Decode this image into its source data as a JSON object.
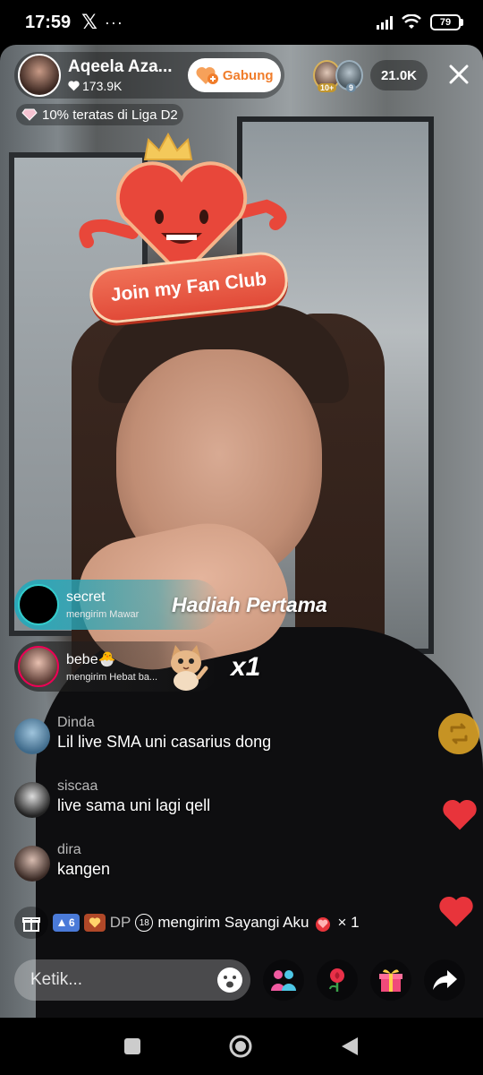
{
  "status_bar": {
    "time": "17:59",
    "x_app": "𝕏",
    "more": "···",
    "battery": "79"
  },
  "host": {
    "name": "Aqeela Aza...",
    "likes": "173.9K",
    "join_label": "Gabung"
  },
  "viewers": {
    "badge1": "10+",
    "badge2": "9",
    "count": "21.0K"
  },
  "league": {
    "text": "10% teratas di Liga D2"
  },
  "fan_club": {
    "label": "Join my Fan Club"
  },
  "gifts": [
    {
      "user": "secret",
      "action": "mengirim Mawar"
    },
    {
      "user": "bebe🐣",
      "action": "mengirim Hebat ba..."
    }
  ],
  "gift_title": "Hadiah Pertama",
  "gift_multiplier": "x1",
  "comments": [
    {
      "user": "Dinda",
      "message": "Lil live SMA uni casarius dong"
    },
    {
      "user": "siscaa",
      "message": "live sama uni lagi qell"
    },
    {
      "user": "dira",
      "message": "kangen"
    }
  ],
  "gift_row": {
    "level": "6",
    "name": "DP",
    "text": "mengirim Sayangi Aku",
    "count": "× 1"
  },
  "input": {
    "placeholder": "Ketik..."
  },
  "colors": {
    "accent": "#f07d2b",
    "banner_teal": "#2ba7b8",
    "heart": "#e8343b"
  }
}
